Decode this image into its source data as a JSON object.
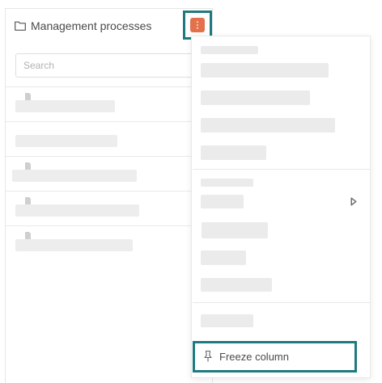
{
  "panel": {
    "title": "Management processes",
    "icon": "folder-icon"
  },
  "search": {
    "placeholder": "Search",
    "value": ""
  },
  "list": {
    "items": [
      {
        "icon": "document-icon",
        "label": ""
      },
      {
        "icon": "",
        "label": ""
      },
      {
        "icon": "document-icon",
        "label": ""
      },
      {
        "icon": "document-icon",
        "label": ""
      },
      {
        "icon": "document-icon",
        "label": ""
      }
    ]
  },
  "menu_button": {
    "icon": "kebab-menu-icon",
    "color": "#e3714c",
    "highlight_color": "#1f7a80"
  },
  "dropdown": {
    "freeze_column_label": "Freeze column",
    "freeze_icon": "pin-icon",
    "submenu_icon": "submenu-arrow-icon"
  }
}
